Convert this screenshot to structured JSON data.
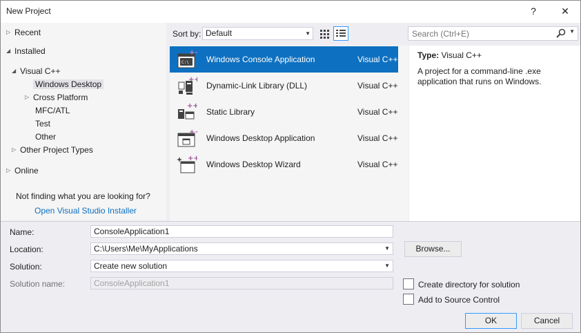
{
  "window": {
    "title": "New Project",
    "help_label": "?",
    "close_label": "✕"
  },
  "tree": {
    "recent": "Recent",
    "installed": "Installed",
    "visual_cpp": "Visual C++",
    "windows_desktop": "Windows Desktop",
    "cross_platform": "Cross Platform",
    "mfc_atl": "MFC/ATL",
    "test": "Test",
    "other": "Other",
    "other_project_types": "Other Project Types",
    "online": "Online",
    "not_finding": "Not finding what you are looking for?",
    "installer_link": "Open Visual Studio Installer"
  },
  "sort": {
    "label": "Sort by:",
    "value": "Default"
  },
  "search": {
    "placeholder": "Search (Ctrl+E)"
  },
  "templates": [
    {
      "name": "Windows Console Application",
      "lang": "Visual C++",
      "icon": "console-app-icon"
    },
    {
      "name": "Dynamic-Link Library (DLL)",
      "lang": "Visual C++",
      "icon": "dll-icon"
    },
    {
      "name": "Static Library",
      "lang": "Visual C++",
      "icon": "static-library-icon"
    },
    {
      "name": "Windows Desktop Application",
      "lang": "Visual C++",
      "icon": "desktop-app-icon"
    },
    {
      "name": "Windows Desktop Wizard",
      "lang": "Visual C++",
      "icon": "desktop-wizard-icon"
    }
  ],
  "description": {
    "type_label": "Type:",
    "type_value": "Visual C++",
    "text": "A project for a command-line .exe application that runs on Windows."
  },
  "form": {
    "name_label": "Name:",
    "name_value": "ConsoleApplication1",
    "location_label": "Location:",
    "location_value": "C:\\Users\\Me\\MyApplications",
    "solution_label": "Solution:",
    "solution_value": "Create new solution",
    "solution_name_label": "Solution name:",
    "solution_name_value": "ConsoleApplication1",
    "browse_label": "Browse...",
    "create_dir_label": "Create directory for solution",
    "source_control_label": "Add to Source Control",
    "ok_label": "OK",
    "cancel_label": "Cancel"
  },
  "colors": {
    "accent": "#0e70c0",
    "selection_text": "#ffffff",
    "cpp_purple": "#9b4f96"
  }
}
